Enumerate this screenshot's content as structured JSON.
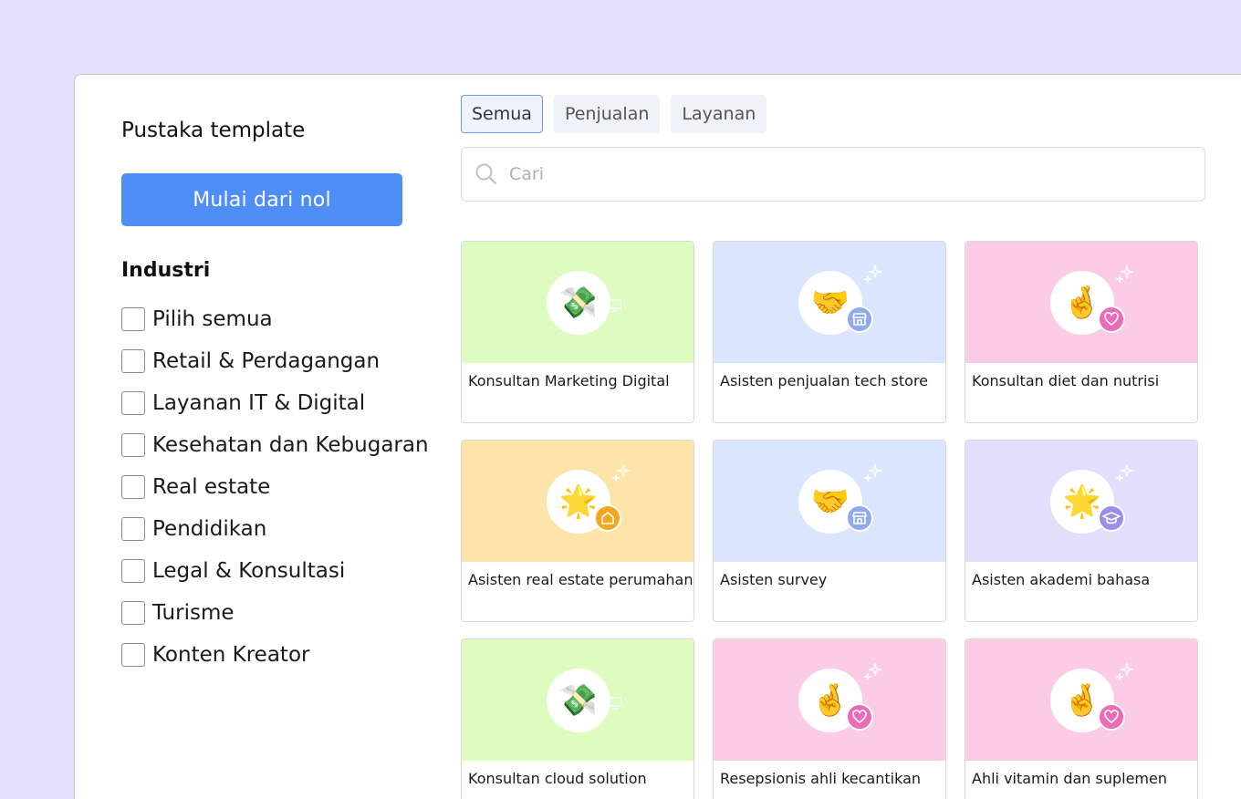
{
  "sidebar": {
    "title": "Pustaka template",
    "start_button": "Mulai dari nol",
    "industry_heading": "Industri",
    "filters": [
      "Pilih semua",
      "Retail & Perdagangan",
      "Layanan IT & Digital",
      "Kesehatan dan Kebugaran",
      "Real estate",
      "Pendidikan",
      "Legal & Konsultasi",
      "Turisme",
      "Konten Kreator"
    ]
  },
  "tabs": [
    "Semua",
    "Penjualan",
    "Layanan"
  ],
  "active_tab": "Semua",
  "search": {
    "placeholder": "Cari"
  },
  "colors": {
    "background": "#e4dfff",
    "primary": "#4f8ef7",
    "card_green": "#dffcc0",
    "card_blue": "#dbe5fd",
    "card_pink": "#fccbe5",
    "card_orange": "#fde4ab",
    "card_lavender": "#e4defd",
    "badge_blue": "#8fa8ee",
    "badge_pink": "#ec6ab8",
    "badge_orange": "#f4a71c",
    "badge_purple": "#9b8ee9"
  },
  "cards": [
    {
      "title": "Konsultan Marketing Digital",
      "bg": "#dffcc0",
      "emoji": "💸",
      "emoji_name": "money-with-wings-icon",
      "badge": "monitor-icon",
      "badge_color": "none",
      "sparkle": false
    },
    {
      "title": "Asisten penjualan tech store",
      "bg": "#dbe5fd",
      "emoji": "🤝",
      "emoji_name": "handshake-icon",
      "badge": "store-icon",
      "badge_color": "#8fa8ee",
      "sparkle": true
    },
    {
      "title": "Konsultan diet dan nutrisi",
      "bg": "#fccbe5",
      "emoji": "🤞",
      "emoji_name": "crossed-fingers-icon",
      "badge": "heart-icon",
      "badge_color": "#ec6ab8",
      "sparkle": true
    },
    {
      "title": "Asisten real estate perumahan",
      "bg": "#fde4ab",
      "emoji": "🌟",
      "emoji_name": "glowing-star-icon",
      "badge": "home-icon",
      "badge_color": "#f4a71c",
      "sparkle": true
    },
    {
      "title": "Asisten survey",
      "bg": "#dbe5fd",
      "emoji": "🤝",
      "emoji_name": "handshake-icon",
      "badge": "store-icon",
      "badge_color": "#8fa8ee",
      "sparkle": true
    },
    {
      "title": "Asisten akademi bahasa",
      "bg": "#e4defd",
      "emoji": "🌟",
      "emoji_name": "glowing-star-icon",
      "badge": "graduation-cap-icon",
      "badge_color": "#9b8ee9",
      "sparkle": true
    },
    {
      "title": "Konsultan cloud solution",
      "bg": "#dffcc0",
      "emoji": "💸",
      "emoji_name": "money-with-wings-icon",
      "badge": "monitor-icon",
      "badge_color": "none",
      "sparkle": false
    },
    {
      "title": "Resepsionis ahli kecantikan",
      "bg": "#fccbe5",
      "emoji": "🤞",
      "emoji_name": "crossed-fingers-icon",
      "badge": "heart-icon",
      "badge_color": "#ec6ab8",
      "sparkle": true
    },
    {
      "title": "Ahli vitamin dan suplemen",
      "bg": "#fccbe5",
      "emoji": "🤞",
      "emoji_name": "crossed-fingers-icon",
      "badge": "heart-icon",
      "badge_color": "#ec6ab8",
      "sparkle": true
    }
  ]
}
